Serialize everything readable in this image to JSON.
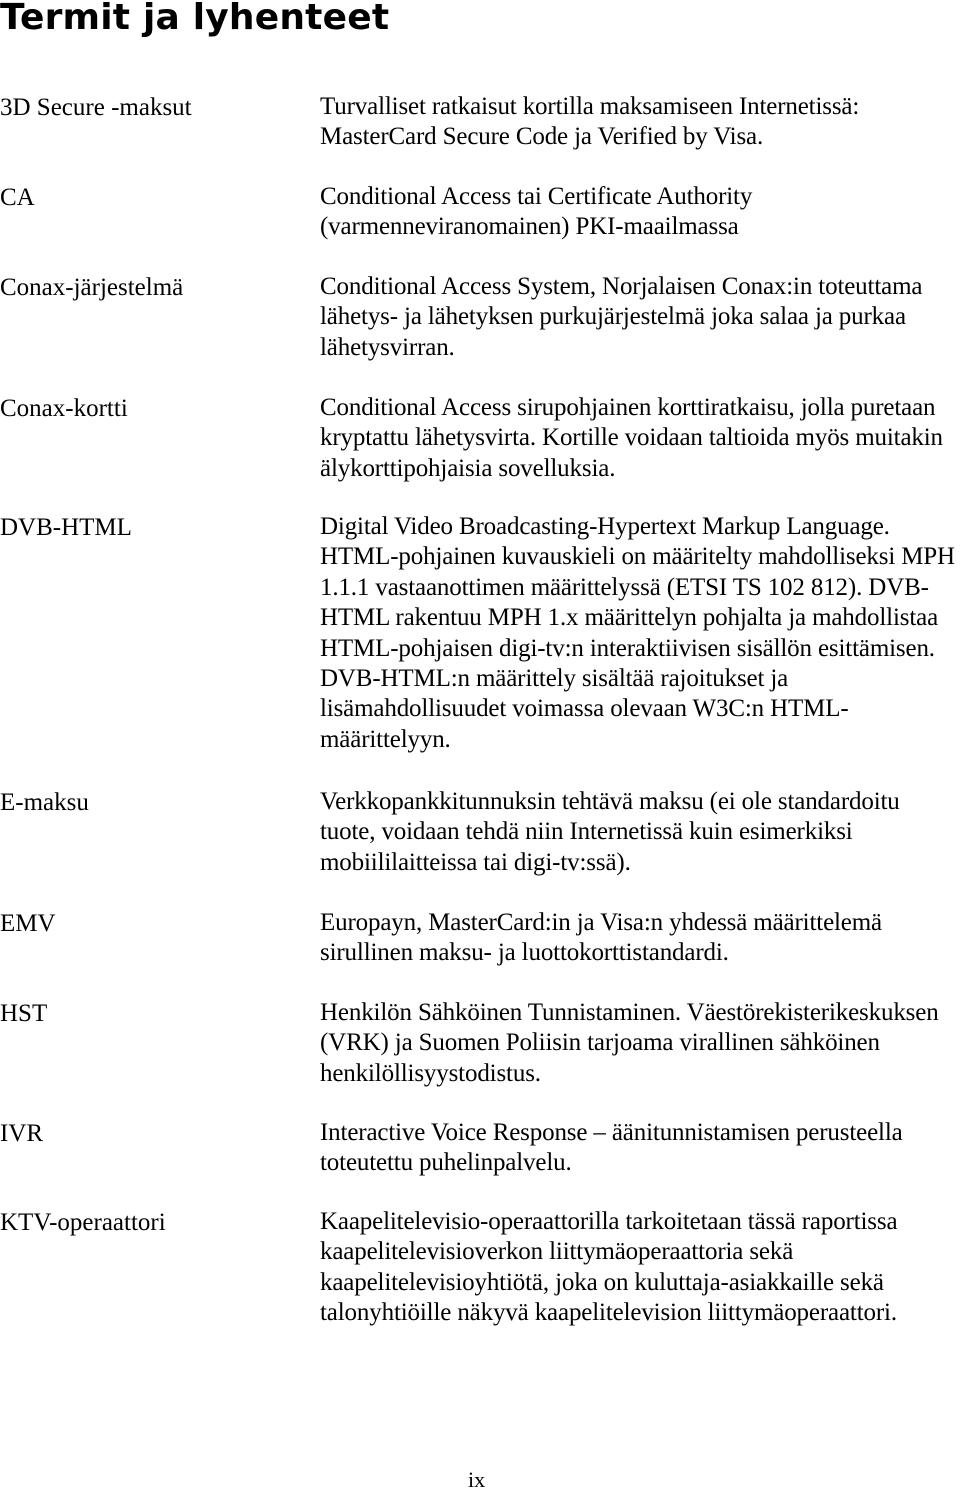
{
  "document": {
    "title": "Termit ja lyhenteet",
    "page_number": "ix"
  },
  "glossary": [
    {
      "term": "3D Secure -maksut",
      "definition": "Turvalliset ratkaisut kortilla maksamiseen Internetissä: MasterCard Secure Code ja Verified by Visa."
    },
    {
      "term": "CA",
      "definition": "Conditional Access tai Certificate Authority (varmenneviranomainen) PKI-maailmassa"
    },
    {
      "term": "Conax-järjestelmä",
      "definition": "Conditional Access System, Norjalaisen Conax:in toteuttama lähetys- ja lähetyksen purkujärjestelmä joka salaa ja purkaa lähetysvirran."
    },
    {
      "term": "Conax-kortti",
      "definition": "Conditional Access sirupohjainen korttiratkaisu, jolla puretaan kryptattu lähetysvirta. Kortille voidaan taltioida myös muitakin älykorttipohjaisia sovelluksia."
    },
    {
      "term": "DVB-HTML",
      "definition": "Digital Video Broadcasting-Hypertext Markup Language. HTML-pohjainen kuvauskieli on määritelty mahdolliseksi MPH 1.1.1 vastaanottimen määrittelyssä (ETSI TS 102 812). DVB-HTML rakentuu MPH 1.x määrittelyn pohjalta ja mahdollistaa HTML-pohjaisen digi-tv:n interaktiivisen sisällön esittämisen. DVB-HTML:n määrittely sisältää rajoitukset ja lisämahdollisuudet voimassa olevaan W3C:n HTML-määrittelyyn."
    },
    {
      "term": "E-maksu",
      "definition": "Verkkopankkitunnuksin tehtävä maksu (ei ole standardoitu tuote, voidaan tehdä niin Internetissä kuin esimerkiksi mobiililaitteissa tai digi-tv:ssä)."
    },
    {
      "term": "EMV",
      "definition": "Europayn, MasterCard:in ja Visa:n yhdessä määrittelemä sirullinen maksu- ja luottokorttistandardi."
    },
    {
      "term": "HST",
      "definition": "Henkilön Sähköinen Tunnistaminen. Väestörekisterikeskuksen (VRK) ja Suomen Poliisin tarjoama virallinen sähköinen henkilöllisyystodistus."
    },
    {
      "term": "IVR",
      "definition": "Interactive Voice Response – äänitunnistamisen perusteella toteutettu puhelinpalvelu."
    },
    {
      "term": "KTV-operaattori",
      "definition": "Kaapelitelevisio-operaattorilla tarkoitetaan tässä raportissa kaapelitelevisioverkon liittymäoperaattoria sekä kaapelitelevisioyhtiötä, joka on kuluttaja-asiakkaille sekä talonyhtiöille näkyvä kaapelitelevision liittymäoperaattori."
    }
  ]
}
